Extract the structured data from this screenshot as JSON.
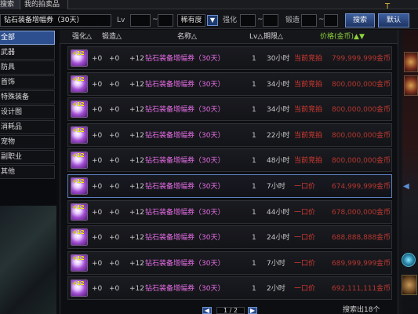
{
  "tabs": [
    {
      "label": "搜索"
    },
    {
      "label": "我的拍卖品"
    }
  ],
  "search": {
    "name_value": "钻石装备增幅券（30天）",
    "lv_label": "Lv",
    "tilde": "~",
    "rarity_value": "稀有度",
    "enhance_label": "强化",
    "forge_label": "锻造",
    "search_button": "搜索",
    "default_button": "默认",
    "dropdown_arrow": "▼"
  },
  "categories": [
    {
      "label": "全部"
    },
    {
      "label": "武器"
    },
    {
      "label": "防具"
    },
    {
      "label": "首饰"
    },
    {
      "label": "特殊装备"
    },
    {
      "label": "设计图"
    },
    {
      "label": "消耗品"
    },
    {
      "label": "宠物"
    },
    {
      "label": "副职业"
    },
    {
      "label": "其他"
    }
  ],
  "columns": {
    "enhance": "强化△",
    "forge": "锻造△",
    "name": "名称△",
    "lv": "Lv△",
    "time": "期限△",
    "price": "价格(金币)▲▼"
  },
  "rows": [
    {
      "icon_label": "+12",
      "enh": "+0",
      "forge": "+0",
      "amp": "+12",
      "name": "钻石装备增幅券（30天）",
      "lv": "1",
      "time": "30小时",
      "type": "当前竞拍",
      "price": "799,999,999",
      "unit": "金币"
    },
    {
      "icon_label": "+12",
      "enh": "+0",
      "forge": "+0",
      "amp": "+12",
      "name": "钻石装备增幅券（30天）",
      "lv": "1",
      "time": "34小时",
      "type": "当前竞拍",
      "price": "800,000,000",
      "unit": "金币"
    },
    {
      "icon_label": "+12",
      "enh": "+0",
      "forge": "+0",
      "amp": "+12",
      "name": "钻石装备增幅券（30天）",
      "lv": "1",
      "time": "34小时",
      "type": "当前竞拍",
      "price": "800,000,000",
      "unit": "金币"
    },
    {
      "icon_label": "+12",
      "enh": "+0",
      "forge": "+0",
      "amp": "+12",
      "name": "钻石装备增幅券（30天）",
      "lv": "1",
      "time": "22小时",
      "type": "当前竞拍",
      "price": "800,000,000",
      "unit": "金币"
    },
    {
      "icon_label": "+12",
      "enh": "+0",
      "forge": "+0",
      "amp": "+12",
      "name": "钻石装备增幅券（30天）",
      "lv": "1",
      "time": "48小时",
      "type": "当前竞拍",
      "price": "800,000,000",
      "unit": "金币"
    },
    {
      "icon_label": "+12",
      "enh": "+0",
      "forge": "+0",
      "amp": "+12",
      "name": "钻石装备增幅券（30天）",
      "lv": "1",
      "time": "7小时",
      "type": "一口价",
      "price": "674,999,999",
      "unit": "金币"
    },
    {
      "icon_label": "+12",
      "enh": "+0",
      "forge": "+0",
      "amp": "+12",
      "name": "钻石装备增幅券（30天）",
      "lv": "1",
      "time": "44小时",
      "type": "一口价",
      "price": "678,000,000",
      "unit": "金币"
    },
    {
      "icon_label": "+12",
      "enh": "+0",
      "forge": "+0",
      "amp": "+12",
      "name": "钻石装备增幅券（30天）",
      "lv": "1",
      "time": "24小时",
      "type": "一口价",
      "price": "688,888,888",
      "unit": "金币"
    },
    {
      "icon_label": "+12",
      "enh": "+0",
      "forge": "+0",
      "amp": "+12",
      "name": "钻石装备增幅券（30天）",
      "lv": "1",
      "time": "7小时",
      "type": "一口价",
      "price": "689,999,999",
      "unit": "金币"
    },
    {
      "icon_label": "+12",
      "enh": "+0",
      "forge": "+0",
      "amp": "+12",
      "name": "钻石装备增幅券（30天）",
      "lv": "1",
      "time": "2小时",
      "type": "一口价",
      "price": "692,111,111",
      "unit": "金币"
    }
  ],
  "pager": {
    "prev": "◀",
    "text": "1 / 2",
    "next": "▶"
  },
  "result_text": "搜索出18个",
  "colors": {
    "accent": "#2e4f8f",
    "item_name": "#e66de6",
    "price_red": "#b4372f",
    "price_header_green": "#8ed13a"
  }
}
